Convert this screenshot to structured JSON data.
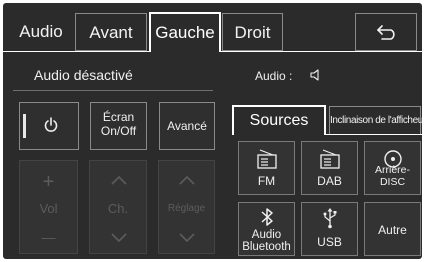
{
  "tabs": [
    {
      "label": "Audio",
      "active": false
    },
    {
      "label": "Avant",
      "active": false
    },
    {
      "label": "Gauche",
      "active": true
    },
    {
      "label": "Droit",
      "active": false
    }
  ],
  "back_icon": "return-arrow-icon",
  "status": {
    "text": "Audio désactivé"
  },
  "audio_indicator": {
    "label": "Audio :",
    "icon": "speaker-icon"
  },
  "controls": {
    "power_icon": "power-icon",
    "screen_line1": "Écran",
    "screen_line2": "On/Off",
    "advanced": "Avancé"
  },
  "disabled_controls": {
    "vol": "Vol",
    "channel": "Ch.",
    "tuning": "Réglage",
    "plus": "+",
    "minus": "—"
  },
  "sources_tabs": {
    "sources": "Sources",
    "inclination": "Inclinaison de l'afficheur"
  },
  "sources": [
    {
      "label": "FM",
      "icon": "radio-icon"
    },
    {
      "label": "DAB",
      "icon": "radio-icon"
    },
    {
      "label": "Arrière-DISC",
      "icon": "disc-icon"
    },
    {
      "label_line1": "Audio",
      "label_line2": "Bluetooth",
      "icon": "bluetooth-icon"
    },
    {
      "label": "USB",
      "icon": "usb-icon"
    },
    {
      "label": "Autre"
    }
  ],
  "colors": {
    "background": "#2b2b2b",
    "text": "#f2f2f2",
    "border": "#8a8a8a",
    "disabled_text": "#5c5c5c"
  }
}
